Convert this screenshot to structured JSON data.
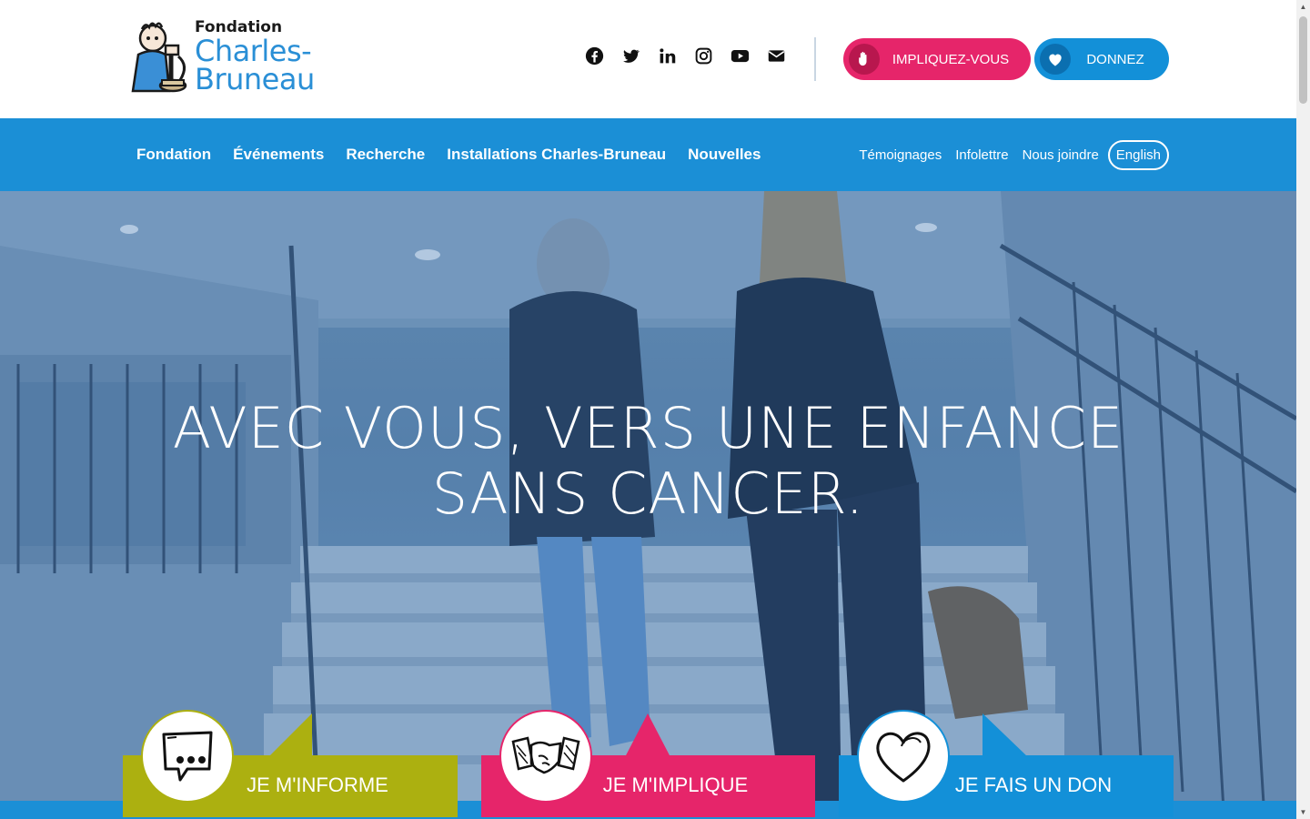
{
  "logo": {
    "line1": "Fondation",
    "line2": "Charles-",
    "line3": "Bruneau"
  },
  "socials": [
    "facebook-icon",
    "twitter-icon",
    "linkedin-icon",
    "instagram-icon",
    "youtube-icon",
    "envelope-icon"
  ],
  "cta": {
    "implique_label": "IMPLIQUEZ-VOUS",
    "donnez_label": "DONNEZ"
  },
  "nav": {
    "main": [
      "Fondation",
      "Événements",
      "Recherche",
      "Installations Charles-Bruneau",
      "Nouvelles"
    ],
    "secondary": [
      "Témoignages",
      "Infolettre",
      "Nous joindre"
    ],
    "language": "English"
  },
  "hero": {
    "title_line1": "AVEC VOUS, VERS UNE ENFANCE",
    "title_line2": "SANS CANCER."
  },
  "cards": [
    {
      "label": "JE M'INFORME",
      "icon": "speech-bubble-icon",
      "color": "#acb010"
    },
    {
      "label": "JE M'IMPLIQUE",
      "icon": "handshake-icon",
      "color": "#e6256a"
    },
    {
      "label": "JE FAIS UN DON",
      "icon": "heart-icon",
      "color": "#1390d8"
    }
  ],
  "colors": {
    "brand_blue": "#1b8fd6",
    "brand_pink": "#e6256a",
    "brand_olive": "#acb010"
  }
}
